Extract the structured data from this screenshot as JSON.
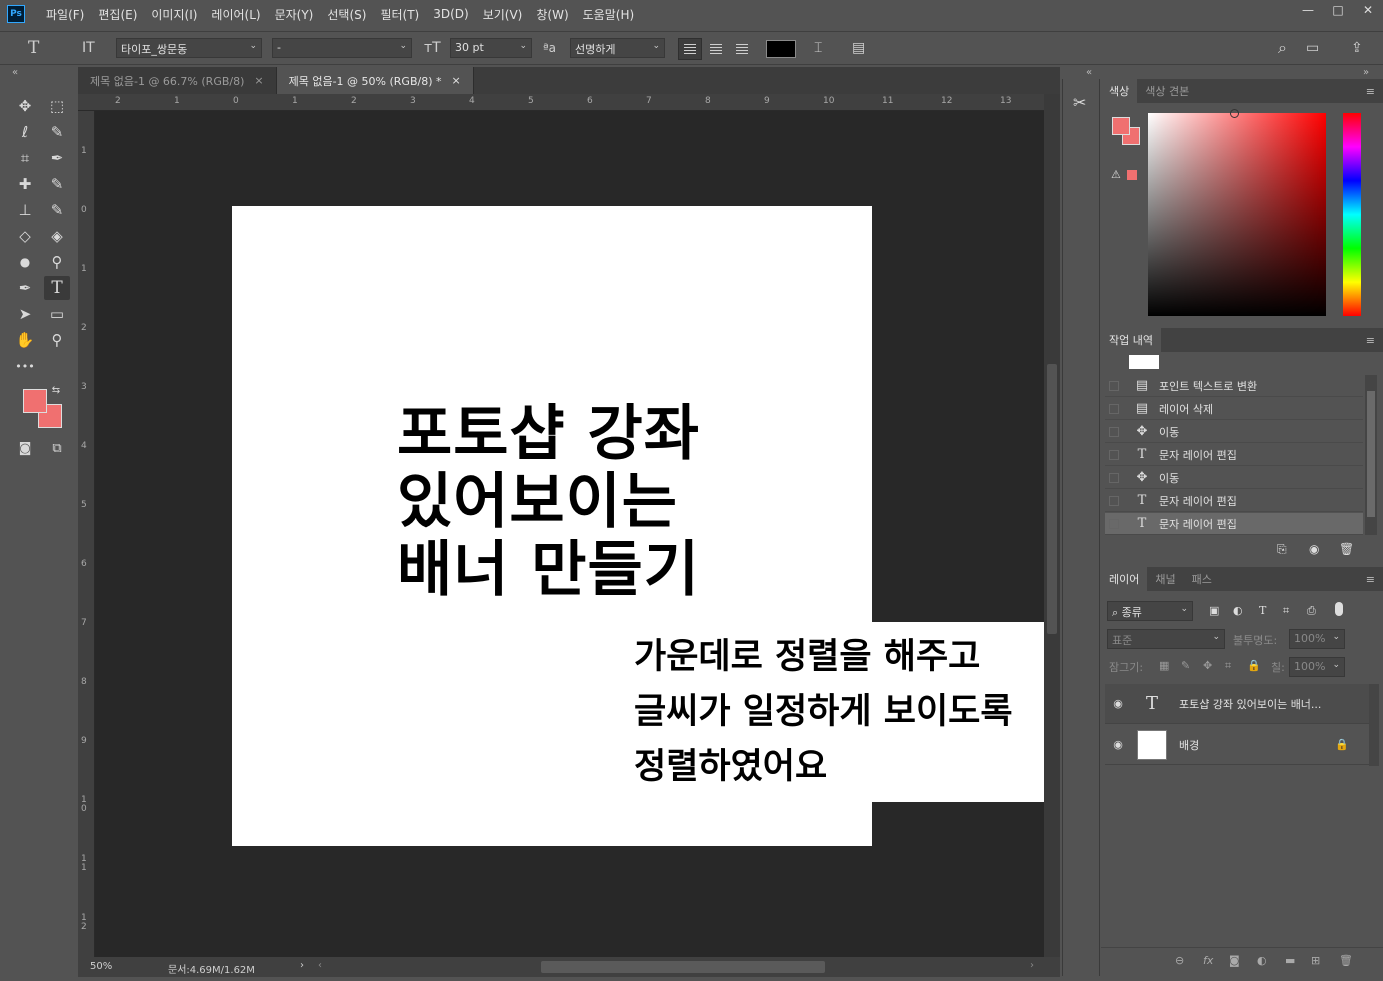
{
  "app": {
    "logo": "Ps"
  },
  "menu": [
    "파일(F)",
    "편집(E)",
    "이미지(I)",
    "레이어(L)",
    "문자(Y)",
    "선택(S)",
    "필터(T)",
    "3D(D)",
    "보기(V)",
    "창(W)",
    "도움말(H)"
  ],
  "window_controls": {
    "minimize": "—",
    "maximize": "□",
    "close": "✕"
  },
  "options": {
    "tool_glyph": "T",
    "orient_glyph": "IT",
    "font_family": "타이포_쌍문동",
    "font_style": "-",
    "size_glyph": "тT",
    "font_size": "30 pt",
    "aa_glyph": "ªa",
    "antialias": "선명하게",
    "color": "#000000",
    "warp_glyph": "⌶",
    "panel_glyph": "▤",
    "search_glyph": "⌕",
    "ws_glyph": "▭",
    "share_glyph": "⇪"
  },
  "tabs": [
    {
      "label": "제목 없음-1 @ 66.7% (RGB/8)",
      "close": "×"
    },
    {
      "label": "제목 없음-1 @ 50% (RGB/8) *",
      "close": "×"
    }
  ],
  "ruler_h": [
    "2",
    "1",
    "0",
    "1",
    "2",
    "3",
    "4",
    "5",
    "6",
    "7",
    "8",
    "9",
    "10",
    "11",
    "12",
    "13"
  ],
  "ruler_v": [
    "1",
    "0",
    "1",
    "2",
    "3",
    "4",
    "5",
    "6",
    "7",
    "8",
    "9",
    "10",
    "11",
    "12"
  ],
  "document": {
    "title_lines": [
      "포토샵 강좌",
      "있어보이는",
      "배너 만들기"
    ],
    "note_lines": [
      "가운데로 정렬을 해주고",
      "글씨가 일정하게 보이도록",
      "정렬하였어요"
    ]
  },
  "status": {
    "zoom": "50%",
    "doc_size": "문서:4.69M/1.62M",
    "arrow": "›",
    "left": "‹",
    "right": "›"
  },
  "tools": {
    "move": "✥",
    "marquee": "⬚",
    "lasso": "ℓ",
    "quick_select": "✎",
    "crop": "⌗",
    "eyedropper": "✒",
    "heal": "✚",
    "brush": "✎",
    "stamp": "⊥",
    "history_brush": "✎",
    "eraser": "◇",
    "bucket": "◈",
    "blur": "●",
    "dodge": "⚲",
    "pen": "✒",
    "type": "T",
    "path_select": "➤",
    "shape": "▭",
    "hand": "✋",
    "zoom": "⚲",
    "more": "•••",
    "swap": "⇆",
    "quickmask": "◙",
    "screen": "⧉"
  },
  "colors": {
    "foreground": "#f07070",
    "background": "#f07070",
    "accent": "#f07070"
  },
  "color_panel": {
    "tabs": [
      "색상",
      "색상 견본"
    ],
    "menu": "≡",
    "warn": "⚠"
  },
  "history": {
    "tab": "작업 내역",
    "menu": "≡",
    "items": [
      {
        "icon": "▤",
        "label": "포인트 텍스트로 변환"
      },
      {
        "icon": "▤",
        "label": "레이어 삭제"
      },
      {
        "icon": "✥",
        "label": "이동"
      },
      {
        "icon": "T",
        "label": "문자 레이어 편집"
      },
      {
        "icon": "✥",
        "label": "이동"
      },
      {
        "icon": "T",
        "label": "문자 레이어 편집"
      },
      {
        "icon": "T",
        "label": "문자 레이어 편집"
      }
    ],
    "footer_icons": [
      "⎘",
      "◉",
      "🗑"
    ]
  },
  "layers": {
    "tabs": [
      "레이어",
      "채널",
      "패스"
    ],
    "menu": "≡",
    "filter": "종류",
    "filter_icons": [
      "▣",
      "◐",
      "T",
      "⌗",
      "⎙"
    ],
    "blend_mode": "표준",
    "opacity_label": "불투명도:",
    "opacity": "100%",
    "lock_label": "잠그기:",
    "lock_icons": [
      "▦",
      "✎",
      "✥",
      "⌗",
      "🔒"
    ],
    "fill_label": "칠:",
    "fill": "100%",
    "items": [
      {
        "eye": "◉",
        "thumb": "T",
        "name": "포토샵 강좌 있어보이는 배너..."
      },
      {
        "eye": "◉",
        "thumb": "",
        "name": "배경",
        "lock": "🔒"
      }
    ],
    "footer_icons": [
      "⊖",
      "fx",
      "◙",
      "◐",
      "▬",
      "⊞",
      "🗑"
    ]
  },
  "midstrip": {
    "tool_glyph": "✂",
    "collapse": "«",
    "expand": "»"
  }
}
